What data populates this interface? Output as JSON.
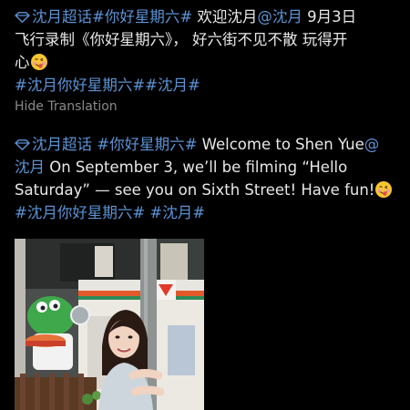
{
  "original": {
    "line1": {
      "topic_tag": "沈月超话",
      "hashtag": "#你好星期六#",
      "text_a": " 欢迎沈月",
      "mention": "@沈月",
      "text_b": "  9月3日"
    },
    "line2": "飞行录制《你好星期六》， 好六街不见不散 玩得开",
    "line3": "心",
    "hashtags": "#沈月你好星期六##沈月#"
  },
  "hide_translation_label": "Hide Translation",
  "translation": {
    "line1": {
      "topic_tag": "沈月超话",
      "hashtag": " #你好星期六#",
      "text": " Welcome to Shen Yue",
      "mention_start": "@"
    },
    "line2": {
      "mention_end": "沈月",
      "text": " On September 3, we’ll be filming “Hello"
    },
    "line3": "Saturday” — see you on Sixth Street! Have fun!",
    "hashtags": "#沈月你好星期六# #沈月#"
  },
  "colors": {
    "link": "#5b93d6",
    "text": "#e8e8e8",
    "muted": "#8a8a8a",
    "background": "#000000"
  },
  "icons": [
    "super-topic-gem-icon",
    "yum-face-emoji-icon"
  ]
}
